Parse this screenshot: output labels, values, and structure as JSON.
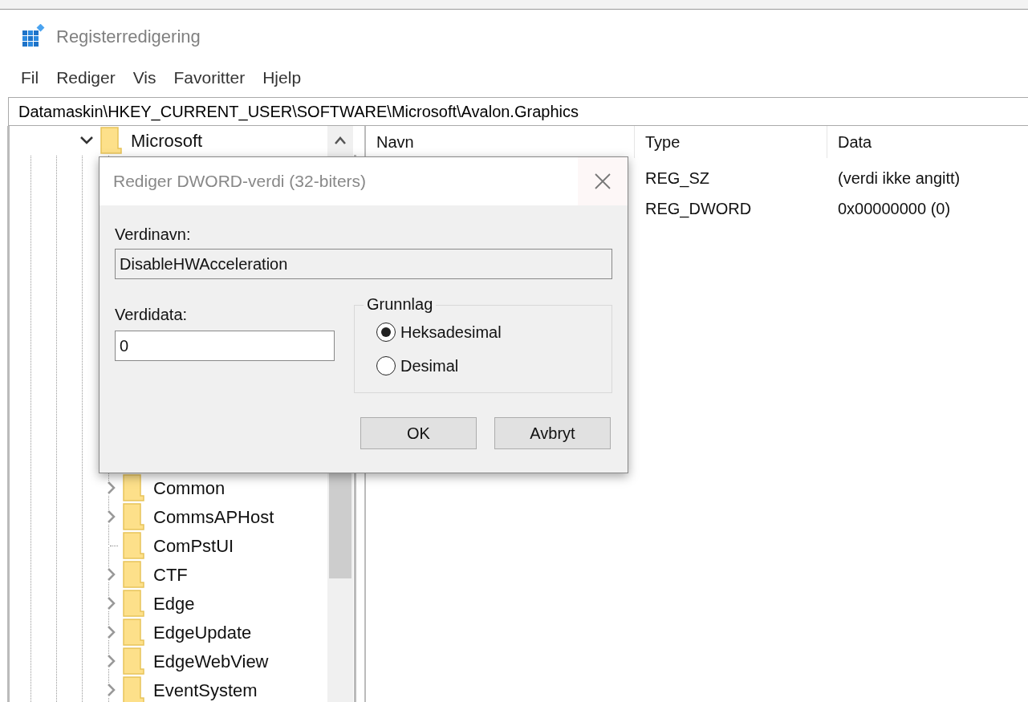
{
  "window": {
    "title": "Registerredigering"
  },
  "menu": [
    {
      "label": "Fil"
    },
    {
      "label": "Rediger"
    },
    {
      "label": "Vis"
    },
    {
      "label": "Favoritter"
    },
    {
      "label": "Hjelp"
    }
  ],
  "address_bar": {
    "value": "Datamaskin\\HKEY_CURRENT_USER\\SOFTWARE\\Microsoft\\Avalon.Graphics"
  },
  "tree": {
    "items": [
      {
        "label": "Microsoft",
        "expanded": true,
        "children": [
          {
            "label": "Common",
            "has_children": true
          },
          {
            "label": "CommsAPHost",
            "has_children": true
          },
          {
            "label": "ComPstUI",
            "has_children": false
          },
          {
            "label": "CTF",
            "has_children": true
          },
          {
            "label": "Edge",
            "has_children": true
          },
          {
            "label": "EdgeUpdate",
            "has_children": true
          },
          {
            "label": "EdgeWebView",
            "has_children": true
          },
          {
            "label": "EventSystem",
            "has_children": true
          }
        ]
      }
    ]
  },
  "values_list": {
    "columns": [
      "Navn",
      "Type",
      "Data"
    ],
    "rows": [
      {
        "type": "REG_SZ",
        "data": "(verdi ikke angitt)"
      },
      {
        "type": "REG_DWORD",
        "data": "0x00000000 (0)"
      }
    ]
  },
  "dialog": {
    "title": "Rediger DWORD-verdi (32-biters)",
    "value_name_label": "Verdinavn:",
    "value_name": "DisableHWAcceleration",
    "value_data_label": "Verdidata:",
    "value_data": "0",
    "base_group": "Grunnlag",
    "radios": [
      {
        "label": "Heksadesimal",
        "selected": true
      },
      {
        "label": "Desimal",
        "selected": false
      }
    ],
    "buttons": [
      "OK",
      "Avbryt"
    ]
  }
}
